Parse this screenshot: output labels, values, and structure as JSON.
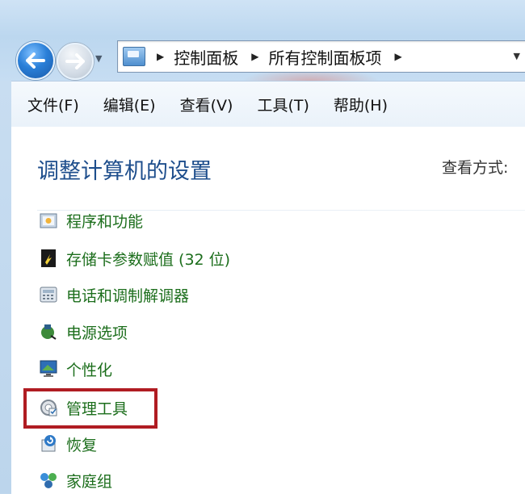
{
  "addressbar": {
    "crumbs": [
      "控制面板",
      "所有控制面板项"
    ]
  },
  "menubar": {
    "items": [
      "文件(F)",
      "编辑(E)",
      "查看(V)",
      "工具(T)",
      "帮助(H)"
    ]
  },
  "content": {
    "title": "调整计算机的设置",
    "view_by_label": "查看方式:",
    "items": [
      {
        "label": "程序和功能",
        "icon": "programs-features-icon"
      },
      {
        "label": "存储卡参数赋值 (32 位)",
        "icon": "memory-card-icon"
      },
      {
        "label": "电话和调制解调器",
        "icon": "phone-modem-icon"
      },
      {
        "label": "电源选项",
        "icon": "power-options-icon"
      },
      {
        "label": "个性化",
        "icon": "personalization-icon"
      },
      {
        "label": "管理工具",
        "icon": "admin-tools-icon"
      },
      {
        "label": "恢复",
        "icon": "recovery-icon"
      },
      {
        "label": "家庭组",
        "icon": "homegroup-icon"
      }
    ],
    "highlighted_item": "管理工具"
  },
  "colors": {
    "link_green": "#1c6e1c",
    "title_blue": "#1e4e8c",
    "highlight_red": "#b01c22"
  }
}
